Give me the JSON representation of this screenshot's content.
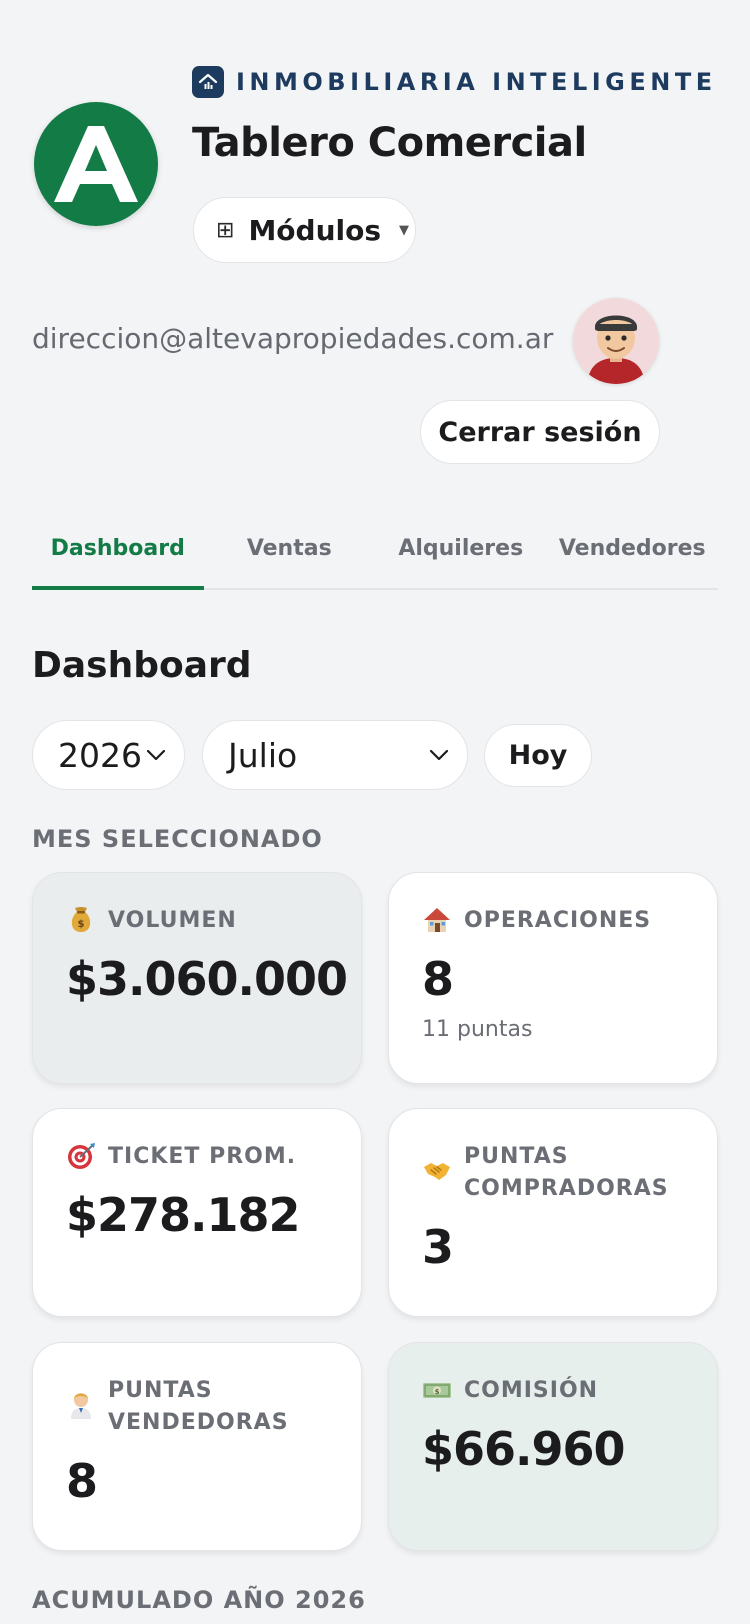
{
  "header": {
    "brand": "INMOBILIARIA INTELIGENTE",
    "logo_letter": "A",
    "title": "Tablero Comercial",
    "modules_label": "Módulos",
    "email": "direccion@altevapropiedades.com.ar",
    "logout_label": "Cerrar sesión"
  },
  "tabs": [
    {
      "label": "Dashboard",
      "active": true
    },
    {
      "label": "Ventas",
      "active": false
    },
    {
      "label": "Alquileres",
      "active": false
    },
    {
      "label": "Vendedores",
      "active": false
    }
  ],
  "dashboard": {
    "title": "Dashboard",
    "year": "2026",
    "month": "Julio",
    "today_label": "Hoy",
    "selected_month_label": "MES SELECCIONADO",
    "cumulative_label": "ACUMULADO AÑO 2026",
    "cards": {
      "volumen": {
        "label": "VOLUMEN",
        "value": "$3.060.000",
        "icon": "money-bag-icon"
      },
      "operaciones": {
        "label": "OPERACIONES",
        "value": "8",
        "sub": "11 puntas",
        "icon": "house-icon"
      },
      "ticket": {
        "label": "TICKET PROM.",
        "value": "$278.182",
        "icon": "target-icon"
      },
      "compradoras": {
        "label_1": "PUNTAS",
        "label_2": "COMPRADORAS",
        "value": "3",
        "icon": "handshake-icon"
      },
      "vendedoras": {
        "label_1": "PUNTAS",
        "label_2": "VENDEDORAS",
        "value": "8",
        "icon": "person-icon"
      },
      "comision": {
        "label": "COMISIÓN",
        "value": "$66.960",
        "icon": "banknote-icon"
      }
    }
  },
  "colors": {
    "brand_green": "#137b45",
    "brand_navy": "#1d3a5f",
    "background": "#f3f4f6",
    "muted_text": "#6b6e74"
  }
}
